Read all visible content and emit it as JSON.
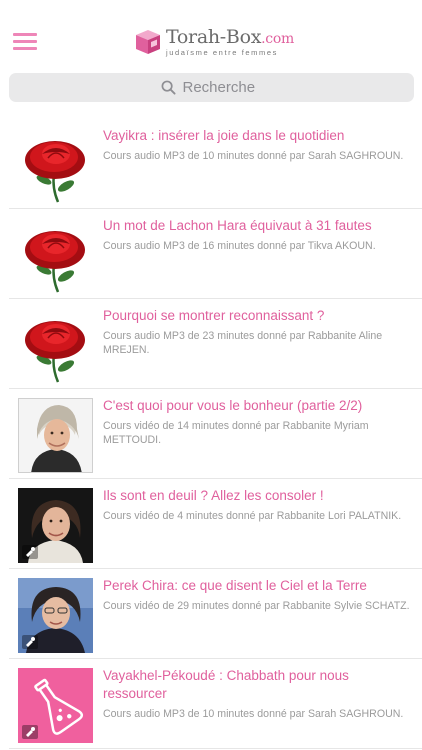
{
  "header": {
    "logo_main": "Torah-Box",
    "logo_domain": ".com",
    "logo_tagline": "judaïsme entre femmes",
    "brand_color": "#e0609d"
  },
  "search": {
    "placeholder": "Recherche"
  },
  "items": [
    {
      "title": "Vayikra : insérer la joie dans le quotidien",
      "description": "Cours audio MP3 de 10 minutes donné par Sarah SAGHROUN.",
      "thumbnail": "rose",
      "media_icon": ""
    },
    {
      "title": "Un mot de Lachon Hara équivaut à 31 fautes",
      "description": "Cours audio MP3 de 16 minutes donné par Tikva AKOUN.",
      "thumbnail": "rose",
      "media_icon": ""
    },
    {
      "title": "Pourquoi se montrer reconnaissant ?",
      "description": "Cours audio MP3 de 23 minutes donné par Rabbanite Aline MREJEN.",
      "thumbnail": "rose",
      "media_icon": ""
    },
    {
      "title": "C'est quoi pour vous le bonheur (partie 2/2)",
      "description": "Cours vidéo de 14 minutes donné par Rabbanite Myriam METTOUDI.",
      "thumbnail": "portrait-headscarf",
      "media_icon": ""
    },
    {
      "title": "Ils sont en deuil ? Allez les consoler !",
      "description": "Cours vidéo de 4 minutes donné par Rabbanite Lori PALATNIK.",
      "thumbnail": "portrait-dark",
      "media_icon": "video-icon"
    },
    {
      "title": "Perek Chira: ce que disent le Ciel et la Terre",
      "description": "Cours vidéo de 29 minutes donné par Rabbanite Sylvie SCHATZ.",
      "thumbnail": "portrait-blue",
      "media_icon": "video-icon"
    },
    {
      "title": "Vayakhel-Pékoudé : Chabbath pour nous ressourcer",
      "description": "Cours audio MP3 de 10 minutes donné par Sarah SAGHROUN.",
      "thumbnail": "flask-icon",
      "media_icon": "video-icon"
    }
  ]
}
